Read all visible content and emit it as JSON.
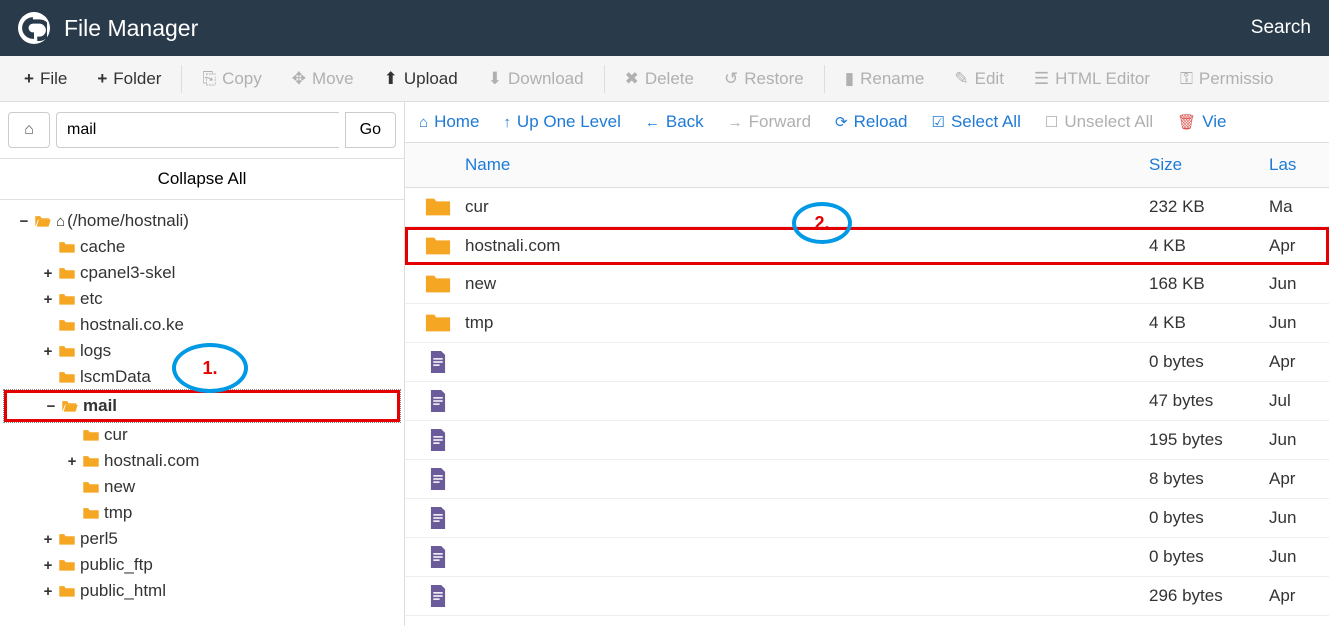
{
  "header": {
    "title": "File Manager",
    "search": "Search"
  },
  "toolbar": {
    "file": "File",
    "folder": "Folder",
    "copy": "Copy",
    "move": "Move",
    "upload": "Upload",
    "download": "Download",
    "delete": "Delete",
    "restore": "Restore",
    "rename": "Rename",
    "edit": "Edit",
    "html_editor": "HTML Editor",
    "permissions": "Permissio"
  },
  "sidebar": {
    "path_value": "mail",
    "go": "Go",
    "collapse_all": "Collapse All",
    "tree": [
      {
        "toggle": "−",
        "indent": 0,
        "icon": "folder-open-home",
        "label": "(/home/hostnali)"
      },
      {
        "toggle": "",
        "indent": 1,
        "icon": "folder",
        "label": "cache"
      },
      {
        "toggle": "+",
        "indent": 1,
        "icon": "folder",
        "label": "cpanel3-skel"
      },
      {
        "toggle": "+",
        "indent": 1,
        "icon": "folder",
        "label": "etc"
      },
      {
        "toggle": "",
        "indent": 1,
        "icon": "folder",
        "label": "hostnali.co.ke"
      },
      {
        "toggle": "+",
        "indent": 1,
        "icon": "folder",
        "label": "logs"
      },
      {
        "toggle": "",
        "indent": 1,
        "icon": "folder",
        "label": "lscmData"
      },
      {
        "toggle": "−",
        "indent": 1,
        "icon": "folder-open",
        "label": "mail",
        "selected": true,
        "highlighted": true
      },
      {
        "toggle": "",
        "indent": 2,
        "icon": "folder",
        "label": "cur"
      },
      {
        "toggle": "+",
        "indent": 2,
        "icon": "folder",
        "label": "hostnali.com"
      },
      {
        "toggle": "",
        "indent": 2,
        "icon": "folder",
        "label": "new"
      },
      {
        "toggle": "",
        "indent": 2,
        "icon": "folder",
        "label": "tmp"
      },
      {
        "toggle": "+",
        "indent": 1,
        "icon": "folder",
        "label": "perl5"
      },
      {
        "toggle": "+",
        "indent": 1,
        "icon": "folder",
        "label": "public_ftp"
      },
      {
        "toggle": "+",
        "indent": 1,
        "icon": "folder",
        "label": "public_html"
      }
    ]
  },
  "content_toolbar": {
    "home": "Home",
    "up_one": "Up One Level",
    "back": "Back",
    "forward": "Forward",
    "reload": "Reload",
    "select_all": "Select All",
    "unselect_all": "Unselect All",
    "view": "Vie"
  },
  "table": {
    "headers": {
      "name": "Name",
      "size": "Size",
      "last": "Las"
    },
    "rows": [
      {
        "icon": "folder",
        "name": "cur",
        "size": "232 KB",
        "last": "Ma"
      },
      {
        "icon": "folder",
        "name": "hostnali.com",
        "size": "4 KB",
        "last": "Apr",
        "highlighted": true
      },
      {
        "icon": "folder",
        "name": "new",
        "size": "168 KB",
        "last": "Jun"
      },
      {
        "icon": "folder",
        "name": "tmp",
        "size": "4 KB",
        "last": "Jun"
      },
      {
        "icon": "file",
        "name": "",
        "size": "0 bytes",
        "last": "Apr"
      },
      {
        "icon": "file",
        "name": "",
        "size": "47 bytes",
        "last": "Jul"
      },
      {
        "icon": "file",
        "name": "",
        "size": "195 bytes",
        "last": "Jun"
      },
      {
        "icon": "file",
        "name": "",
        "size": "8 bytes",
        "last": "Apr"
      },
      {
        "icon": "file",
        "name": "",
        "size": "0 bytes",
        "last": "Jun"
      },
      {
        "icon": "file",
        "name": "",
        "size": "0 bytes",
        "last": "Jun"
      },
      {
        "icon": "file",
        "name": "",
        "size": "296 bytes",
        "last": "Apr"
      }
    ]
  },
  "annotations": {
    "label1": "1.",
    "label2": "2."
  }
}
